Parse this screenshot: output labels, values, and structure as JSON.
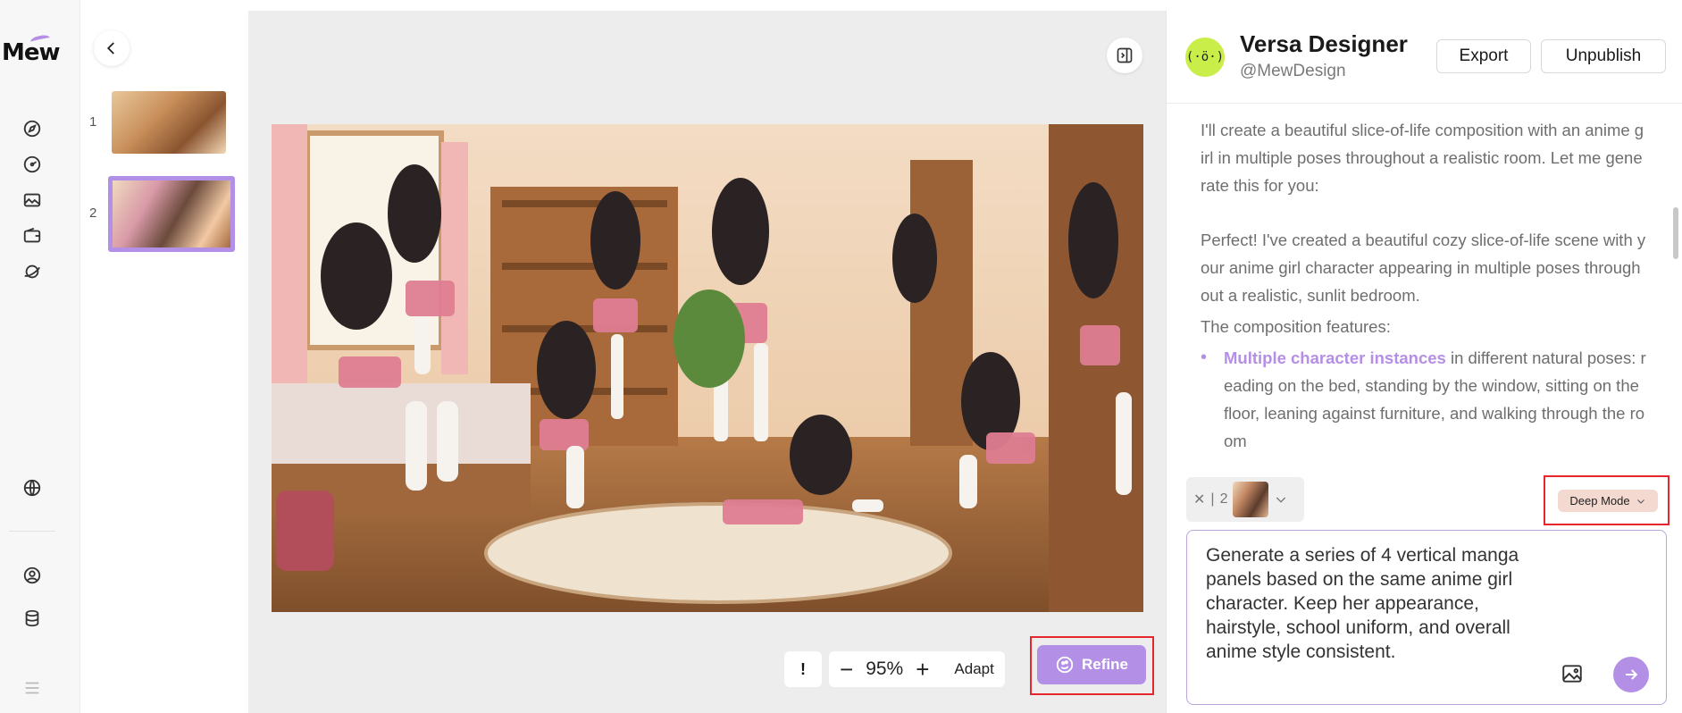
{
  "brand": {
    "logo_text": "Mew"
  },
  "rail": {
    "icons": [
      "compass-icon",
      "palette-icon",
      "gallery-icon",
      "wallet-icon",
      "planet-icon",
      "globe-icon",
      "user-icon",
      "database-icon",
      "menu-icon"
    ]
  },
  "pages": {
    "items": [
      {
        "number": "1",
        "selected": false
      },
      {
        "number": "2",
        "selected": true
      }
    ]
  },
  "canvas": {
    "zoom_value": "95%",
    "info_label": "!",
    "zoom_out_label": "−",
    "zoom_in_label": "+",
    "adapt_label": "Adapt",
    "refine_label": "Refine"
  },
  "chat": {
    "agent_name": "Versa Designer",
    "agent_handle": "@MewDesign",
    "avatar_glyph": "(·ö·)",
    "export_label": "Export",
    "unpublish_label": "Unpublish",
    "message_1": "I'll create a beautiful slice-of-life composition with an anime girl in multiple poses throughout a realistic room. Let me generate this for you:",
    "message_2": "Perfect! I've created a beautiful cozy slice-of-life scene with your anime girl character appearing in multiple poses throughout a realistic, sunlit bedroom.",
    "features_label": "The composition features:",
    "bullet_1_highlight": "Multiple character instances",
    "bullet_1_text": " in different natural poses: reading on the bed, standing by the window, sitting on the floor, leaning against furniture, and walking through the room",
    "attachment_close": "✕",
    "attachment_count": "2",
    "deep_mode_label": "Deep Mode",
    "prompt_text": "Generate a series of 4 vertical manga panels based on the same anime girl character. Keep her appearance, hairstyle, school uniform, and overall anime style consistent."
  },
  "colors": {
    "accent": "#b390e6",
    "highlight_box": "#e5262a",
    "avatar_bg": "#c9ee4a"
  }
}
